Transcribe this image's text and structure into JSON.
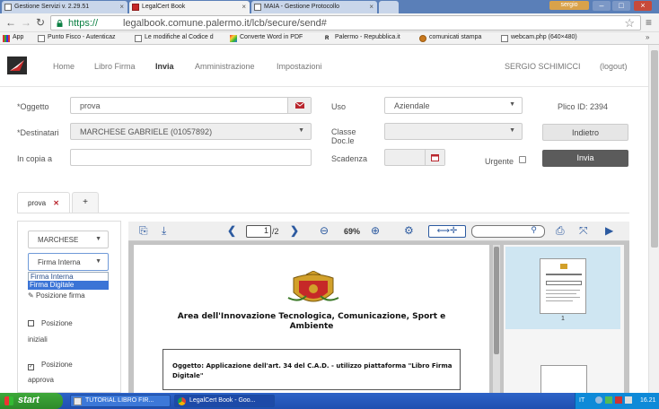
{
  "browser": {
    "tabs": [
      {
        "label": "Gestione Servizi v. 2.29.51",
        "active": false
      },
      {
        "label": "LegalCert Book",
        "active": true
      },
      {
        "label": "MAIA - Gestione Protocollo",
        "active": false
      }
    ],
    "user_chip": "sergio",
    "url_scheme": "https://",
    "url_rest": "legalbook.comune.palermo.it/lcb/secure/send#",
    "bookmarks": [
      "App",
      "Punto Fisco - Autenticaz",
      "Le modifiche al Codice d",
      "Converte Word in PDF",
      "Palermo - Repubblica.it",
      "comunicati stampa",
      "webcam.php (640×480)"
    ]
  },
  "nav": {
    "links": [
      "Home",
      "Libro Firma",
      "Invia",
      "Amministrazione",
      "Impostazioni"
    ],
    "active": "Invia",
    "user": "SERGIO SCHIMICCI",
    "logout": "(logout)"
  },
  "form": {
    "oggetto_label": "*Oggetto",
    "oggetto_value": "prova",
    "destinatari_label": "*Destinatari",
    "destinatari_value": "MARCHESE GABRIELE (01057892)",
    "in_copia_label": "In copia a",
    "uso_label": "Uso",
    "uso_value": "Aziendale",
    "classe_label": "Classe Doc.le",
    "scadenza_label": "Scadenza",
    "urgente_label": "Urgente",
    "plico_id": "Plico ID: 2394",
    "indietro_label": "Indietro",
    "invia_label": "Invia"
  },
  "doc_tabs": {
    "tab_label": "prova",
    "add_label": "+"
  },
  "signature_panel": {
    "signer": "MARCHESE",
    "firma_selected": "Firma Interna",
    "firma_options": [
      "Firma Interna",
      "Firma Digitale"
    ],
    "highlighted_option": "Firma Digitale",
    "posizione_firma": "Posizione firma",
    "posizione_iniziali_1": "Posizione",
    "posizione_iniziali_2": "iniziali",
    "posizione_approva_1": "Posizione",
    "posizione_approva_2": "approva"
  },
  "viewer": {
    "page_current": "1",
    "page_total": "/2",
    "zoom": "69%",
    "thumb_page": "1",
    "doc_heading": "Area dell'Innovazione Tecnologica, Comunicazione, Sport e Ambiente",
    "oggetto_label": "Oggetto:",
    "oggetto_text": "Applicazione dell'art. 34 del C.A.D. - utilizzo piattaforma \"Libro Firma Digitale\""
  },
  "taskbar": {
    "start": "start",
    "tasks": [
      {
        "label": "TUTORIAL LIBRO FIR...",
        "active": false
      },
      {
        "label": "LegalCert Book - Goo...",
        "active": true
      }
    ],
    "lang": "IT",
    "time": "16.21"
  },
  "colors": {
    "accent_red": "#b9272e",
    "invia_bg": "#5b5b5b",
    "brand_blue": "#2c5aa0"
  }
}
